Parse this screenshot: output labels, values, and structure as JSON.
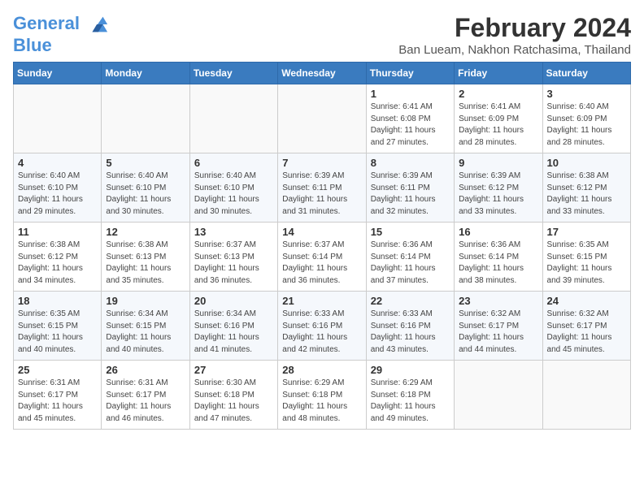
{
  "header": {
    "logo_line1": "General",
    "logo_line2": "Blue",
    "month_year": "February 2024",
    "location": "Ban Lueam, Nakhon Ratchasima, Thailand"
  },
  "weekdays": [
    "Sunday",
    "Monday",
    "Tuesday",
    "Wednesday",
    "Thursday",
    "Friday",
    "Saturday"
  ],
  "weeks": [
    [
      {
        "day": "",
        "info": ""
      },
      {
        "day": "",
        "info": ""
      },
      {
        "day": "",
        "info": ""
      },
      {
        "day": "",
        "info": ""
      },
      {
        "day": "1",
        "info": "Sunrise: 6:41 AM\nSunset: 6:08 PM\nDaylight: 11 hours\nand 27 minutes."
      },
      {
        "day": "2",
        "info": "Sunrise: 6:41 AM\nSunset: 6:09 PM\nDaylight: 11 hours\nand 28 minutes."
      },
      {
        "day": "3",
        "info": "Sunrise: 6:40 AM\nSunset: 6:09 PM\nDaylight: 11 hours\nand 28 minutes."
      }
    ],
    [
      {
        "day": "4",
        "info": "Sunrise: 6:40 AM\nSunset: 6:10 PM\nDaylight: 11 hours\nand 29 minutes."
      },
      {
        "day": "5",
        "info": "Sunrise: 6:40 AM\nSunset: 6:10 PM\nDaylight: 11 hours\nand 30 minutes."
      },
      {
        "day": "6",
        "info": "Sunrise: 6:40 AM\nSunset: 6:10 PM\nDaylight: 11 hours\nand 30 minutes."
      },
      {
        "day": "7",
        "info": "Sunrise: 6:39 AM\nSunset: 6:11 PM\nDaylight: 11 hours\nand 31 minutes."
      },
      {
        "day": "8",
        "info": "Sunrise: 6:39 AM\nSunset: 6:11 PM\nDaylight: 11 hours\nand 32 minutes."
      },
      {
        "day": "9",
        "info": "Sunrise: 6:39 AM\nSunset: 6:12 PM\nDaylight: 11 hours\nand 33 minutes."
      },
      {
        "day": "10",
        "info": "Sunrise: 6:38 AM\nSunset: 6:12 PM\nDaylight: 11 hours\nand 33 minutes."
      }
    ],
    [
      {
        "day": "11",
        "info": "Sunrise: 6:38 AM\nSunset: 6:12 PM\nDaylight: 11 hours\nand 34 minutes."
      },
      {
        "day": "12",
        "info": "Sunrise: 6:38 AM\nSunset: 6:13 PM\nDaylight: 11 hours\nand 35 minutes."
      },
      {
        "day": "13",
        "info": "Sunrise: 6:37 AM\nSunset: 6:13 PM\nDaylight: 11 hours\nand 36 minutes."
      },
      {
        "day": "14",
        "info": "Sunrise: 6:37 AM\nSunset: 6:14 PM\nDaylight: 11 hours\nand 36 minutes."
      },
      {
        "day": "15",
        "info": "Sunrise: 6:36 AM\nSunset: 6:14 PM\nDaylight: 11 hours\nand 37 minutes."
      },
      {
        "day": "16",
        "info": "Sunrise: 6:36 AM\nSunset: 6:14 PM\nDaylight: 11 hours\nand 38 minutes."
      },
      {
        "day": "17",
        "info": "Sunrise: 6:35 AM\nSunset: 6:15 PM\nDaylight: 11 hours\nand 39 minutes."
      }
    ],
    [
      {
        "day": "18",
        "info": "Sunrise: 6:35 AM\nSunset: 6:15 PM\nDaylight: 11 hours\nand 40 minutes."
      },
      {
        "day": "19",
        "info": "Sunrise: 6:34 AM\nSunset: 6:15 PM\nDaylight: 11 hours\nand 40 minutes."
      },
      {
        "day": "20",
        "info": "Sunrise: 6:34 AM\nSunset: 6:16 PM\nDaylight: 11 hours\nand 41 minutes."
      },
      {
        "day": "21",
        "info": "Sunrise: 6:33 AM\nSunset: 6:16 PM\nDaylight: 11 hours\nand 42 minutes."
      },
      {
        "day": "22",
        "info": "Sunrise: 6:33 AM\nSunset: 6:16 PM\nDaylight: 11 hours\nand 43 minutes."
      },
      {
        "day": "23",
        "info": "Sunrise: 6:32 AM\nSunset: 6:17 PM\nDaylight: 11 hours\nand 44 minutes."
      },
      {
        "day": "24",
        "info": "Sunrise: 6:32 AM\nSunset: 6:17 PM\nDaylight: 11 hours\nand 45 minutes."
      }
    ],
    [
      {
        "day": "25",
        "info": "Sunrise: 6:31 AM\nSunset: 6:17 PM\nDaylight: 11 hours\nand 45 minutes."
      },
      {
        "day": "26",
        "info": "Sunrise: 6:31 AM\nSunset: 6:17 PM\nDaylight: 11 hours\nand 46 minutes."
      },
      {
        "day": "27",
        "info": "Sunrise: 6:30 AM\nSunset: 6:18 PM\nDaylight: 11 hours\nand 47 minutes."
      },
      {
        "day": "28",
        "info": "Sunrise: 6:29 AM\nSunset: 6:18 PM\nDaylight: 11 hours\nand 48 minutes."
      },
      {
        "day": "29",
        "info": "Sunrise: 6:29 AM\nSunset: 6:18 PM\nDaylight: 11 hours\nand 49 minutes."
      },
      {
        "day": "",
        "info": ""
      },
      {
        "day": "",
        "info": ""
      }
    ]
  ]
}
